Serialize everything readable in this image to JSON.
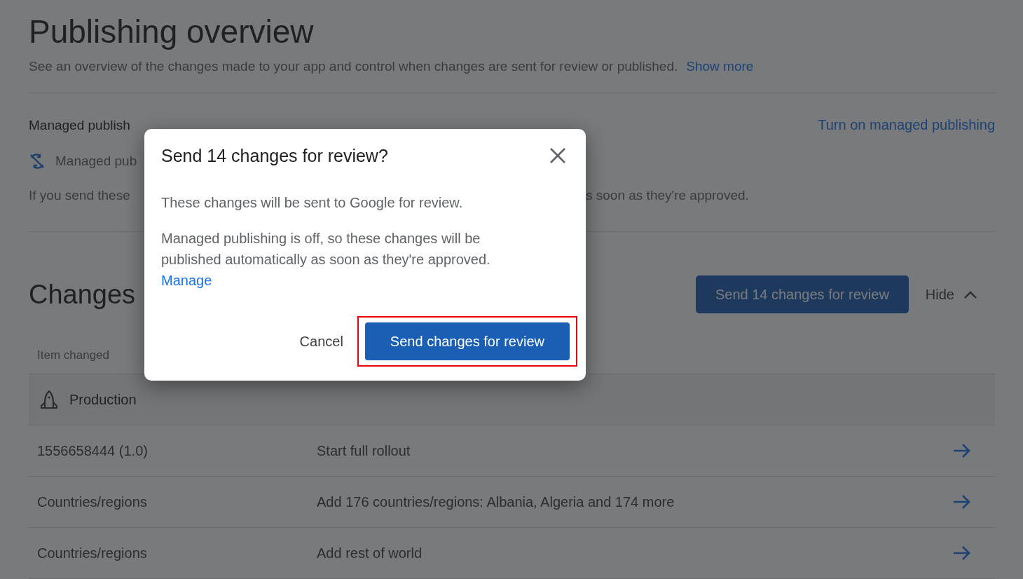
{
  "page": {
    "title": "Publishing overview",
    "subtitle": "See an overview of the changes made to your app and control when changes are sent for review or published.",
    "subtitle_link": "Show more"
  },
  "managed_publishing": {
    "heading": "Managed publish",
    "link": "Turn on managed publishing",
    "status": "Managed pub",
    "note_start": "If you send these",
    "note_end": "s soon as they're approved."
  },
  "changes": {
    "heading": "Changes",
    "send_button": "Send 14 changes for review",
    "hide_button": "Hide",
    "expanded": true,
    "columns": [
      "Item changed"
    ],
    "group": "Production",
    "rows": [
      {
        "item": "1556658444 (1.0)",
        "change": "Start full rollout"
      },
      {
        "item": "Countries/regions",
        "change": "Add 176 countries/regions: Albania, Algeria and 174 more"
      },
      {
        "item": "Countries/regions",
        "change": "Add rest of world"
      }
    ]
  },
  "dialog": {
    "title": "Send 14 changes for review?",
    "body": "These changes will be sent to Google for review.",
    "detail": "Managed publishing is off, so these changes will be published automatically as soon as they're approved.",
    "link": "Manage",
    "cancel": "Cancel",
    "confirm": "Send changes for review",
    "confirm_highlighted": true
  }
}
